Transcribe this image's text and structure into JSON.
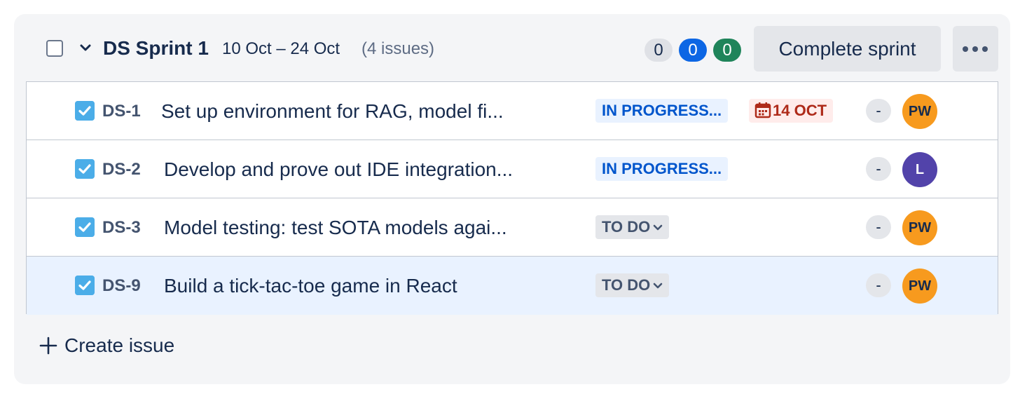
{
  "sprint": {
    "name": "DS Sprint 1",
    "dates": "10 Oct – 24 Oct",
    "issue_count": "(4 issues)",
    "counts": {
      "todo": "0",
      "in_progress": "0",
      "done": "0"
    },
    "complete_label": "Complete sprint"
  },
  "issues": [
    {
      "key": "DS-1",
      "summary": "Set up environment for RAG, model fi...",
      "status": "IN PROGRESS...",
      "status_type": "inprogress",
      "due": "14 OCT",
      "estimate": "-",
      "assignee": "PW",
      "avatar_color": "#f79a1e",
      "avatar_text_color": "#172b4d"
    },
    {
      "key": "DS-2",
      "summary": "Develop and prove out IDE integration...",
      "status": "IN PROGRESS...",
      "status_type": "inprogress",
      "due": "",
      "estimate": "-",
      "assignee": "L",
      "avatar_color": "#5243aa",
      "avatar_text_color": "#ffffff"
    },
    {
      "key": "DS-3",
      "summary": "Model testing: test SOTA models agai...",
      "status": "TO DO",
      "status_type": "todo",
      "due": "",
      "estimate": "-",
      "assignee": "PW",
      "avatar_color": "#f79a1e",
      "avatar_text_color": "#172b4d"
    },
    {
      "key": "DS-9",
      "summary": "Build a tick-tac-toe game in React",
      "status": "TO DO",
      "status_type": "todo",
      "due": "",
      "estimate": "-",
      "assignee": "PW",
      "avatar_color": "#f79a1e",
      "avatar_text_color": "#172b4d",
      "selected": true
    }
  ],
  "create_issue_label": "Create issue",
  "colors": {
    "status_todo_pill": "#dfe1e6",
    "status_inprogress_pill": "#0c66e4",
    "status_done_pill": "#1f845a",
    "issue_type_task": "#4bade8"
  }
}
